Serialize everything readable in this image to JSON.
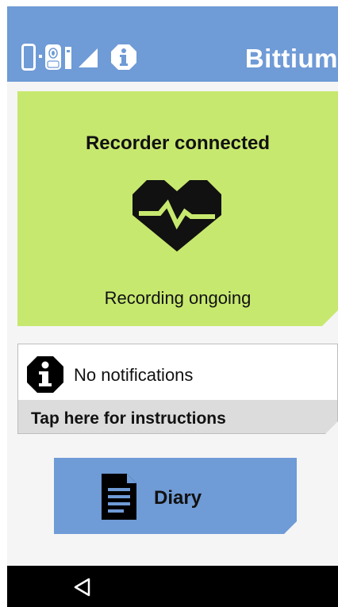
{
  "app_bar": {
    "brand": "Bittium",
    "color": "#6f9bd6",
    "status_icons": [
      "phone-icon",
      "recorder-icon",
      "sensor-icon",
      "signal-icon",
      "info-icon"
    ]
  },
  "status_card": {
    "title": "Recorder connected",
    "subtitle": "Recording ongoing",
    "icon": "heart-ecg-icon",
    "color": "#c7e86f"
  },
  "notifications": {
    "message": "No notifications",
    "instructions": "Tap here for instructions",
    "icon": "info-icon"
  },
  "diary": {
    "label": "Diary",
    "icon": "document-icon",
    "color": "#6f9bd6"
  },
  "nav_bar": {
    "back_icon": "back-triangle-icon"
  }
}
